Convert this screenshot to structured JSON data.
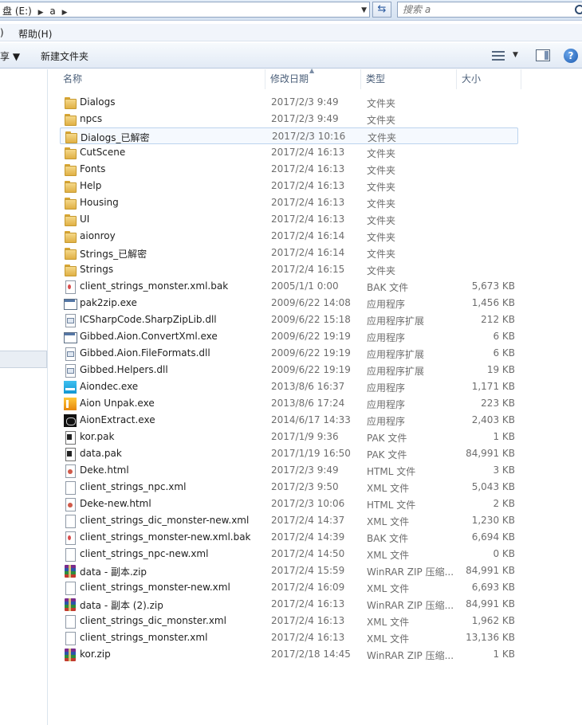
{
  "address": {
    "crumbs": [
      "盘 (E:)",
      "a"
    ],
    "search_placeholder": "搜索 a"
  },
  "menu": {
    "partial_item": ")",
    "help": "帮助(H)"
  },
  "toolbar": {
    "share": "享 ▼",
    "new_folder": "新建文件夹"
  },
  "columns": {
    "name": "名称",
    "date": "修改日期",
    "type": "类型",
    "size": "大小"
  },
  "files": [
    {
      "name": "Dialogs",
      "date": "2017/2/3 9:49",
      "type": "文件夹",
      "size": "",
      "icon": "folder"
    },
    {
      "name": "npcs",
      "date": "2017/2/3 9:49",
      "type": "文件夹",
      "size": "",
      "icon": "folder"
    },
    {
      "name": "Dialogs_已解密",
      "date": "2017/2/3 10:16",
      "type": "文件夹",
      "size": "",
      "icon": "folder"
    },
    {
      "name": "CutScene",
      "date": "2017/2/4 16:13",
      "type": "文件夹",
      "size": "",
      "icon": "folder"
    },
    {
      "name": "Fonts",
      "date": "2017/2/4 16:13",
      "type": "文件夹",
      "size": "",
      "icon": "folder"
    },
    {
      "name": "Help",
      "date": "2017/2/4 16:13",
      "type": "文件夹",
      "size": "",
      "icon": "folder"
    },
    {
      "name": "Housing",
      "date": "2017/2/4 16:13",
      "type": "文件夹",
      "size": "",
      "icon": "folder"
    },
    {
      "name": "UI",
      "date": "2017/2/4 16:13",
      "type": "文件夹",
      "size": "",
      "icon": "folder"
    },
    {
      "name": "aionroy",
      "date": "2017/2/4 16:14",
      "type": "文件夹",
      "size": "",
      "icon": "folder"
    },
    {
      "name": "Strings_已解密",
      "date": "2017/2/4 16:14",
      "type": "文件夹",
      "size": "",
      "icon": "folder"
    },
    {
      "name": "Strings",
      "date": "2017/2/4 16:15",
      "type": "文件夹",
      "size": "",
      "icon": "folder"
    },
    {
      "name": "client_strings_monster.xml.bak",
      "date": "2005/1/1 0:00",
      "type": "BAK 文件",
      "size": "5,673 KB",
      "icon": "doc-bak"
    },
    {
      "name": "pak2zip.exe",
      "date": "2009/6/22 14:08",
      "type": "应用程序",
      "size": "1,456 KB",
      "icon": "exe"
    },
    {
      "name": "ICSharpCode.SharpZipLib.dll",
      "date": "2009/6/22 15:18",
      "type": "应用程序扩展",
      "size": "212 KB",
      "icon": "dll"
    },
    {
      "name": "Gibbed.Aion.ConvertXml.exe",
      "date": "2009/6/22 19:19",
      "type": "应用程序",
      "size": "6 KB",
      "icon": "exe"
    },
    {
      "name": "Gibbed.Aion.FileFormats.dll",
      "date": "2009/6/22 19:19",
      "type": "应用程序扩展",
      "size": "6 KB",
      "icon": "dll"
    },
    {
      "name": "Gibbed.Helpers.dll",
      "date": "2009/6/22 19:19",
      "type": "应用程序扩展",
      "size": "19 KB",
      "icon": "dll"
    },
    {
      "name": "Aiondec.exe",
      "date": "2013/8/6 16:37",
      "type": "应用程序",
      "size": "1,171 KB",
      "icon": "app-cyan"
    },
    {
      "name": "Aion Unpak.exe",
      "date": "2013/8/6 17:24",
      "type": "应用程序",
      "size": "223 KB",
      "icon": "app-orange"
    },
    {
      "name": "AionExtract.exe",
      "date": "2014/6/17 14:33",
      "type": "应用程序",
      "size": "2,403 KB",
      "icon": "app-black"
    },
    {
      "name": "kor.pak",
      "date": "2017/1/9 9:36",
      "type": "PAK 文件",
      "size": "1 KB",
      "icon": "pak"
    },
    {
      "name": "data.pak",
      "date": "2017/1/19 16:50",
      "type": "PAK 文件",
      "size": "84,991 KB",
      "icon": "pak"
    },
    {
      "name": "Deke.html",
      "date": "2017/2/3 9:49",
      "type": "HTML 文件",
      "size": "3 KB",
      "icon": "html"
    },
    {
      "name": "client_strings_npc.xml",
      "date": "2017/2/3 9:50",
      "type": "XML 文件",
      "size": "5,043 KB",
      "icon": "doc"
    },
    {
      "name": "Deke-new.html",
      "date": "2017/2/3 10:06",
      "type": "HTML 文件",
      "size": "2 KB",
      "icon": "html"
    },
    {
      "name": "client_strings_dic_monster-new.xml",
      "date": "2017/2/4 14:37",
      "type": "XML 文件",
      "size": "1,230 KB",
      "icon": "doc"
    },
    {
      "name": "client_strings_monster-new.xml.bak",
      "date": "2017/2/4 14:39",
      "type": "BAK 文件",
      "size": "6,694 KB",
      "icon": "doc-bak"
    },
    {
      "name": "client_strings_npc-new.xml",
      "date": "2017/2/4 14:50",
      "type": "XML 文件",
      "size": "0 KB",
      "icon": "doc"
    },
    {
      "name": "data - 副本.zip",
      "date": "2017/2/4 15:59",
      "type": "WinRAR ZIP 压缩...",
      "size": "84,991 KB",
      "icon": "rar"
    },
    {
      "name": "client_strings_monster-new.xml",
      "date": "2017/2/4 16:09",
      "type": "XML 文件",
      "size": "6,693 KB",
      "icon": "doc"
    },
    {
      "name": "data - 副本 (2).zip",
      "date": "2017/2/4 16:13",
      "type": "WinRAR ZIP 压缩...",
      "size": "84,991 KB",
      "icon": "rar"
    },
    {
      "name": "client_strings_dic_monster.xml",
      "date": "2017/2/4 16:13",
      "type": "XML 文件",
      "size": "1,962 KB",
      "icon": "doc"
    },
    {
      "name": "client_strings_monster.xml",
      "date": "2017/2/4 16:13",
      "type": "XML 文件",
      "size": "13,136 KB",
      "icon": "doc"
    },
    {
      "name": "kor.zip",
      "date": "2017/2/18 14:45",
      "type": "WinRAR ZIP 压缩...",
      "size": "1 KB",
      "icon": "rar"
    }
  ],
  "selected_index": 2
}
